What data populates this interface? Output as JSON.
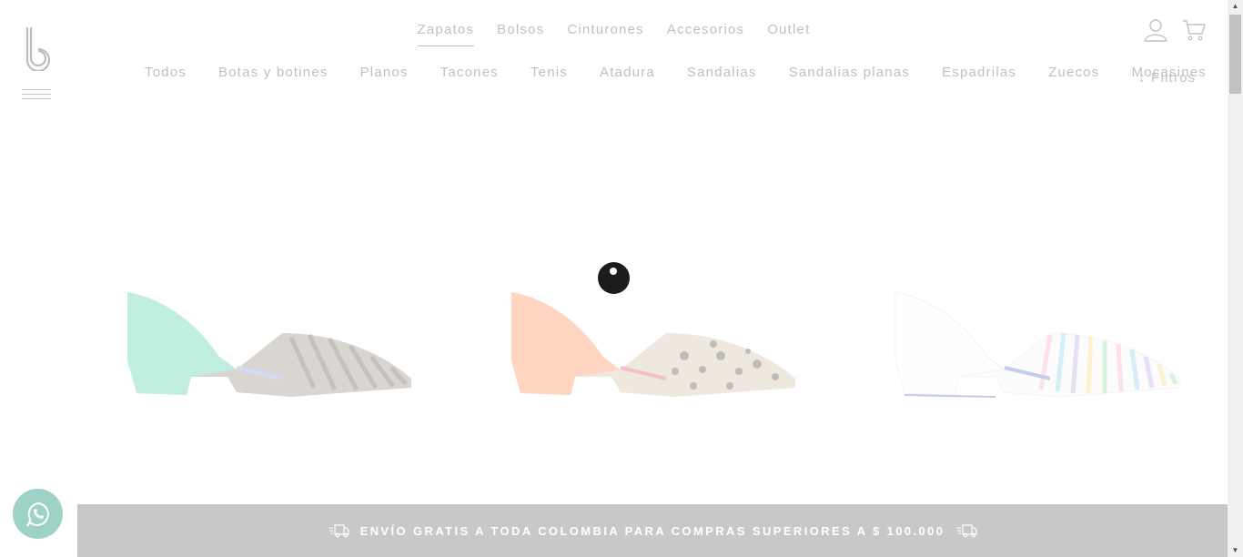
{
  "brand": {
    "logo_icon": "b-logo-icon"
  },
  "top_nav": {
    "items": [
      {
        "label": "Zapatos",
        "active": true
      },
      {
        "label": "Bolsos"
      },
      {
        "label": "Cinturones"
      },
      {
        "label": "Accesorios"
      },
      {
        "label": "Outlet"
      }
    ]
  },
  "header_icons": [
    "user-icon",
    "cart-icon"
  ],
  "categories": {
    "items": [
      {
        "label": "Todos"
      },
      {
        "label": "Botas y botines"
      },
      {
        "label": "Planos"
      },
      {
        "label": "Tacones"
      },
      {
        "label": "Tenis"
      },
      {
        "label": "Atadura"
      },
      {
        "label": "Sandalias"
      },
      {
        "label": "Sandalias planas"
      },
      {
        "label": "Espadrilas"
      },
      {
        "label": "Zuecos"
      },
      {
        "label": "Mocasines"
      }
    ],
    "filters_label": "Filtros"
  },
  "products": [
    {
      "name": "green-zebra-flat",
      "colors": {
        "heel": "#3cc9a2",
        "toe": "#8a7d72"
      }
    },
    {
      "name": "orange-leopard-flat",
      "colors": {
        "heel": "#ff7a3c",
        "toe": "#b9a98c"
      }
    },
    {
      "name": "white-striped-flat",
      "colors": {
        "heel": "#f0f0f0",
        "toe": "#d8b0e0"
      }
    }
  ],
  "banner": {
    "text": "ENVÍO GRATIS A TODA COLOMBIA PARA COMPRAS SUPERIORES A $ 100.000"
  },
  "colors": {
    "whatsapp": "#9fd2c6",
    "banner_bg": "#c8c8c8"
  }
}
